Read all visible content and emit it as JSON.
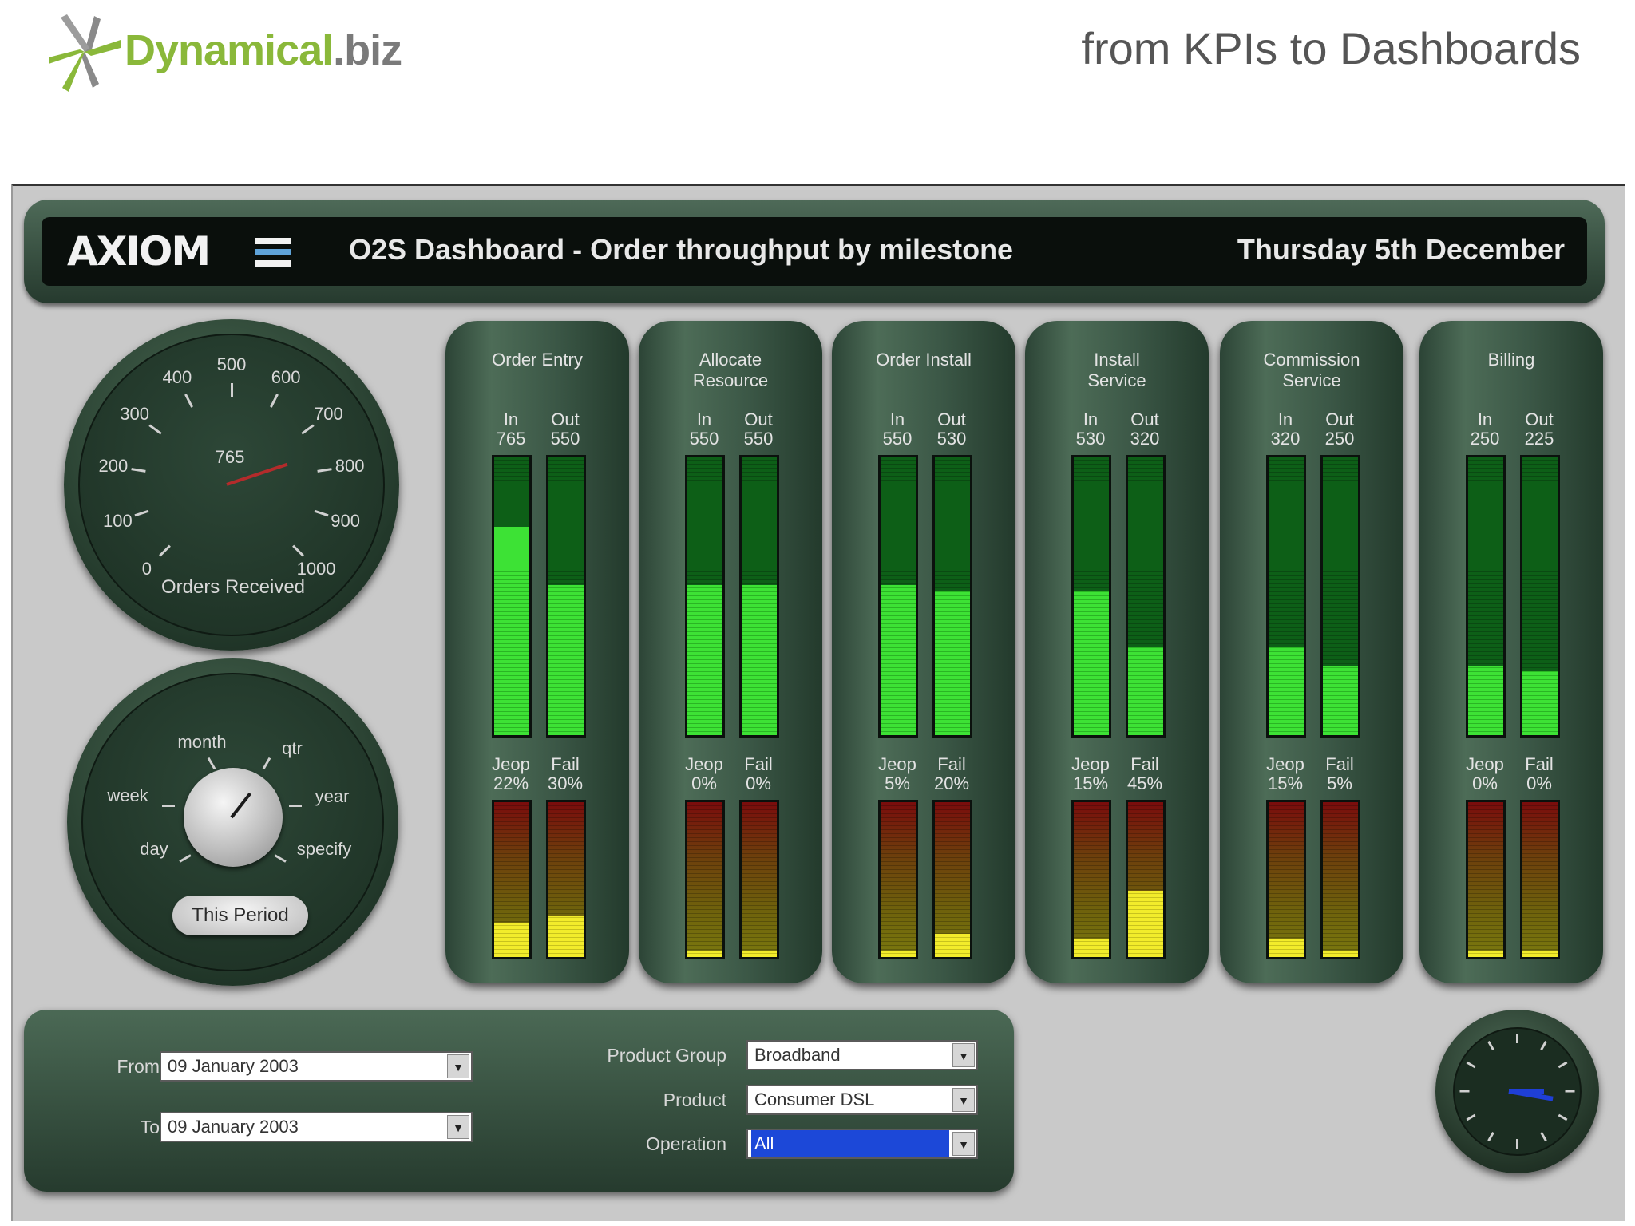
{
  "brand": {
    "name_main": "Dynamical",
    "name_suffix": ".biz",
    "tagline": "from KPIs to Dashboards"
  },
  "colors": {
    "brand_green": "#8ab83a",
    "panel_green": "#3b5746",
    "bar_green": "#3de235",
    "alert_yellow": "#f2ec2b",
    "alert_red": "#7a0c0c",
    "selection_blue": "#1c48d8"
  },
  "header": {
    "logo": "AXIOM",
    "title": "O2S Dashboard - Order throughput by milestone",
    "date": "Thursday 5th December"
  },
  "orders_gauge": {
    "label": "Orders Received",
    "value": 765,
    "min": 0,
    "max": 1000,
    "ticks": [
      "0",
      "100",
      "200",
      "300",
      "400",
      "500",
      "600",
      "700",
      "800",
      "900",
      "1000"
    ]
  },
  "period_selector": {
    "options": [
      "day",
      "week",
      "month",
      "qtr",
      "year",
      "specify"
    ],
    "button": "This Period"
  },
  "milestones": [
    {
      "name": "Order Entry",
      "in": 765,
      "out": 550,
      "jeop": "22%",
      "fail": "30%",
      "in_level": 0.75,
      "out_level": 0.54,
      "jeop_level": 0.22,
      "fail_level": 0.27
    },
    {
      "name": "Allocate\nResource",
      "in": 550,
      "out": 550,
      "jeop": "0%",
      "fail": "0%",
      "in_level": 0.54,
      "out_level": 0.54,
      "jeop_level": 0,
      "fail_level": 0
    },
    {
      "name": "Order Install",
      "in": 550,
      "out": 530,
      "jeop": "5%",
      "fail": "20%",
      "in_level": 0.54,
      "out_level": 0.52,
      "jeop_level": 0,
      "fail_level": 0.15
    },
    {
      "name": "Install\nService",
      "in": 530,
      "out": 320,
      "jeop": "15%",
      "fail": "45%",
      "in_level": 0.52,
      "out_level": 0.32,
      "jeop_level": 0.12,
      "fail_level": 0.43
    },
    {
      "name": "Commission\nService",
      "in": 320,
      "out": 250,
      "jeop": "15%",
      "fail": "5%",
      "in_level": 0.32,
      "out_level": 0.25,
      "jeop_level": 0.12,
      "fail_level": 0
    },
    {
      "name": "Billing",
      "in": 250,
      "out": 225,
      "jeop": "0%",
      "fail": "0%",
      "in_level": 0.25,
      "out_level": 0.23,
      "jeop_level": 0,
      "fail_level": 0
    }
  ],
  "labels": {
    "in": "In",
    "out": "Out",
    "jeop": "Jeop",
    "fail": "Fail"
  },
  "filters": {
    "from_label": "From",
    "from_value": "09  January  2003",
    "to_label": "To",
    "to_value": "09  January  2003",
    "product_group_label": "Product Group",
    "product_group_value": "Broadband",
    "product_label": "Product",
    "product_value": "Consumer DSL",
    "operation_label": "Operation",
    "operation_value": "All"
  },
  "clock_icon": "clock-icon"
}
